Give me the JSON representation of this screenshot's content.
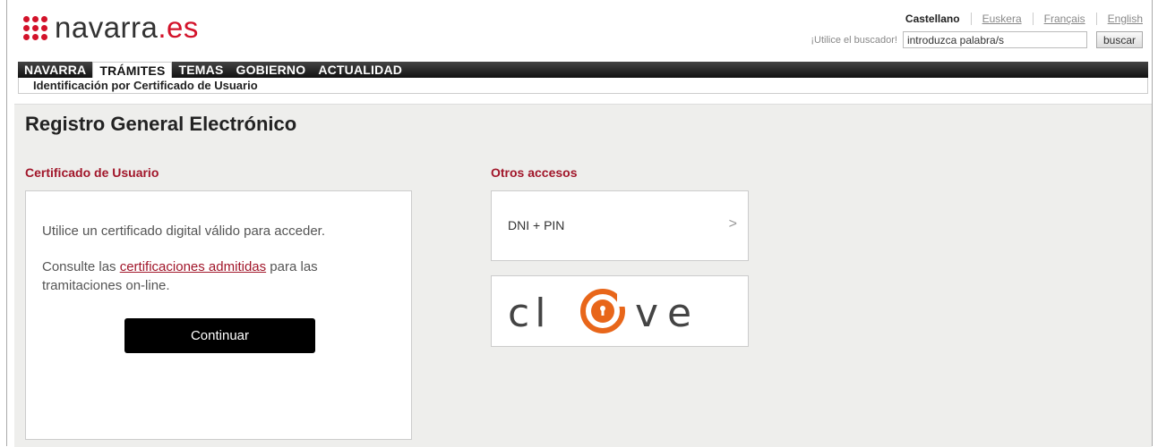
{
  "header": {
    "logo_name": "navarra",
    "logo_tld": ".es",
    "brand_color": "#d3122a",
    "languages": [
      "Castellano",
      "Euskera",
      "Français",
      "English"
    ],
    "active_language": "Castellano",
    "search_hint": "¡Utilice el buscador!",
    "search_value": "introduzca palabra/s",
    "search_button": "buscar"
  },
  "nav": {
    "items": [
      "NAVARRA",
      "TRÁMITES",
      "TEMAS",
      "GOBIERNO",
      "ACTUALIDAD"
    ],
    "active": "TRÁMITES"
  },
  "breadcrumb": "Identificación por Certificado de Usuario",
  "main": {
    "title": "Registro General Electrónico",
    "cert_section": {
      "title": "Certificado de Usuario",
      "text1": "Utilice un certificado digital válido para acceder.",
      "text2_prefix": "Consulte las",
      "text2_link": "certificaciones admitidas",
      "text2_suffix": "para las tramitaciones on-line.",
      "button": "Continuar"
    },
    "other_section": {
      "title": "Otros accesos",
      "dni_label": "DNI + PIN",
      "chevron_icon": "chevron-right-icon",
      "clave_logo": "cl@ve"
    }
  }
}
